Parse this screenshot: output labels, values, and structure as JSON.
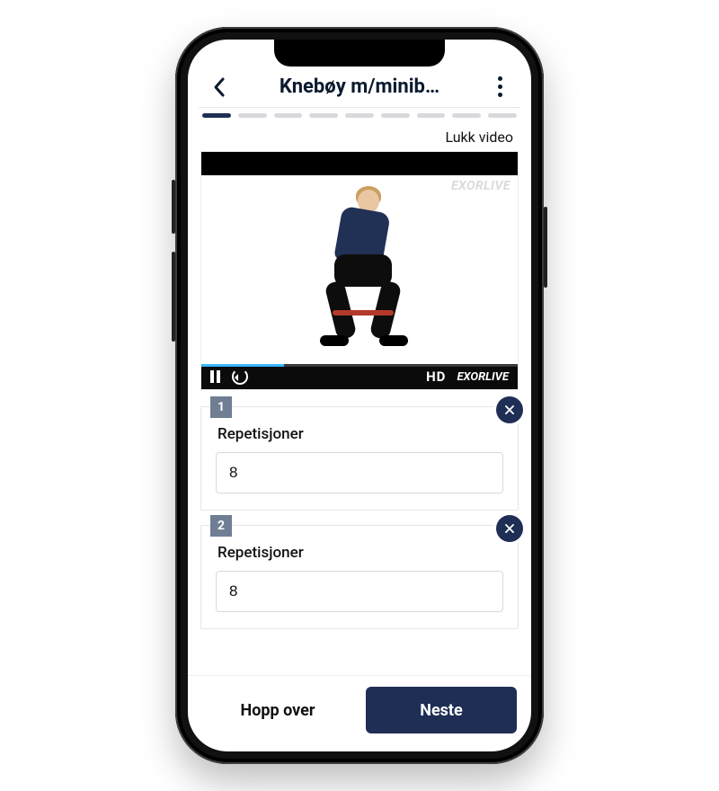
{
  "header": {
    "title": "Knebøy m/minib…"
  },
  "progress": {
    "total": 9,
    "active_index": 0
  },
  "video": {
    "close_label": "Lukk video",
    "quality_label": "HD",
    "brand": "EXORLIVE",
    "watermark": "EXORLIVE"
  },
  "sets": [
    {
      "index_label": "1",
      "field_label": "Repetisjoner",
      "value": "8"
    },
    {
      "index_label": "2",
      "field_label": "Repetisjoner",
      "value": "8"
    }
  ],
  "footer": {
    "skip_label": "Hopp over",
    "next_label": "Neste"
  },
  "colors": {
    "primary": "#1f2e55",
    "progress_inactive": "#d7d9dc",
    "set_badge": "#6f7e93"
  }
}
